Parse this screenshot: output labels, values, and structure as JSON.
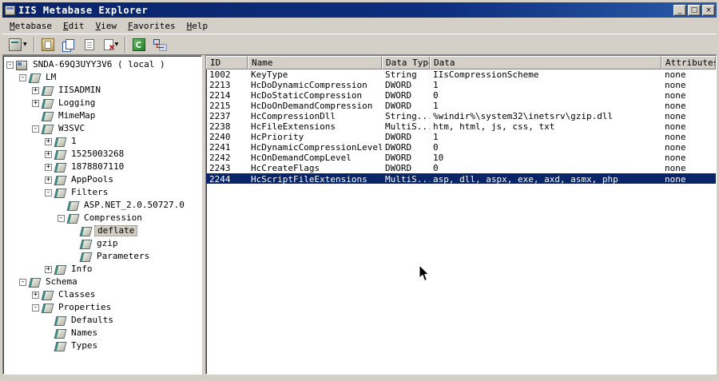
{
  "window": {
    "title": "IIS Metabase Explorer",
    "controls": {
      "minimize": "_",
      "maximize": "□",
      "close": "×"
    }
  },
  "menu": {
    "items": [
      {
        "label": "Metabase"
      },
      {
        "label": "Edit"
      },
      {
        "label": "View"
      },
      {
        "label": "Favorites"
      },
      {
        "label": "Help"
      }
    ]
  },
  "toolbar": {
    "buttons": [
      {
        "name": "new-key-button",
        "icon": "new-key-icon",
        "dropdown": true
      },
      {
        "sep": true
      },
      {
        "name": "paste-button",
        "icon": "clipboard-icon"
      },
      {
        "name": "copy-button",
        "icon": "copy-icon"
      },
      {
        "name": "export-button",
        "icon": "page-icon"
      },
      {
        "name": "delete-button",
        "icon": "delete-icon",
        "dropdown": true
      },
      {
        "sep": true
      },
      {
        "name": "refresh-button",
        "icon": "refresh-icon"
      },
      {
        "name": "connect-button",
        "icon": "network-icon"
      }
    ]
  },
  "tree": {
    "items": [
      {
        "label": "SNDA-69Q3UYY3V6 ( local )",
        "level": 0,
        "expand": "minus",
        "icon": "computer"
      },
      {
        "label": "LM",
        "level": 1,
        "expand": "minus",
        "icon": "key"
      },
      {
        "label": "IISADMIN",
        "level": 2,
        "expand": "plus",
        "icon": "key"
      },
      {
        "label": "Logging",
        "level": 2,
        "expand": "plus",
        "icon": "key"
      },
      {
        "label": "MimeMap",
        "level": 2,
        "expand": "none",
        "icon": "key"
      },
      {
        "label": "W3SVC",
        "level": 2,
        "expand": "minus",
        "icon": "key"
      },
      {
        "label": "1",
        "level": 3,
        "expand": "plus",
        "icon": "key"
      },
      {
        "label": "1525003268",
        "level": 3,
        "expand": "plus",
        "icon": "key"
      },
      {
        "label": "1878807110",
        "level": 3,
        "expand": "plus",
        "icon": "key"
      },
      {
        "label": "AppPools",
        "level": 3,
        "expand": "plus",
        "icon": "key"
      },
      {
        "label": "Filters",
        "level": 3,
        "expand": "minus",
        "icon": "key"
      },
      {
        "label": "ASP.NET_2.0.50727.0",
        "level": 4,
        "expand": "none",
        "icon": "key"
      },
      {
        "label": "Compression",
        "level": 4,
        "expand": "minus",
        "icon": "key"
      },
      {
        "label": "deflate",
        "level": 5,
        "expand": "none",
        "icon": "key",
        "selected": true
      },
      {
        "label": "gzip",
        "level": 5,
        "expand": "none",
        "icon": "key"
      },
      {
        "label": "Parameters",
        "level": 5,
        "expand": "none",
        "icon": "key"
      },
      {
        "label": "Info",
        "level": 3,
        "expand": "plus",
        "icon": "key"
      },
      {
        "label": "Schema",
        "level": 1,
        "expand": "minus",
        "icon": "key"
      },
      {
        "label": "Classes",
        "level": 2,
        "expand": "plus",
        "icon": "key"
      },
      {
        "label": "Properties",
        "level": 2,
        "expand": "minus",
        "icon": "key"
      },
      {
        "label": "Defaults",
        "level": 3,
        "expand": "none",
        "icon": "key"
      },
      {
        "label": "Names",
        "level": 3,
        "expand": "none",
        "icon": "key"
      },
      {
        "label": "Types",
        "level": 3,
        "expand": "none",
        "icon": "key"
      }
    ]
  },
  "table": {
    "columns": [
      "ID",
      "Name",
      "Data Type",
      "Data",
      "Attributes"
    ],
    "rows": [
      [
        "1002",
        "KeyType",
        "String",
        "IIsCompressionScheme",
        "none"
      ],
      [
        "2213",
        "HcDoDynamicCompression",
        "DWORD",
        "1",
        "none"
      ],
      [
        "2214",
        "HcDoStaticCompression",
        "DWORD",
        "0",
        "none"
      ],
      [
        "2215",
        "HcDoOnDemandCompression",
        "DWORD",
        "1",
        "none"
      ],
      [
        "2237",
        "HcCompressionDll",
        "String...",
        "%windir%\\system32\\inetsrv\\gzip.dll",
        "none"
      ],
      [
        "2238",
        "HcFileExtensions",
        "MultiS...",
        "htm, html, js, css, txt",
        "none"
      ],
      [
        "2240",
        "HcPriority",
        "DWORD",
        "1",
        "none"
      ],
      [
        "2241",
        "HcDynamicCompressionLevel",
        "DWORD",
        "0",
        "none"
      ],
      [
        "2242",
        "HcOnDemandCompLevel",
        "DWORD",
        "10",
        "none"
      ],
      [
        "2243",
        "HcCreateFlags",
        "DWORD",
        "0",
        "none"
      ],
      [
        "2244",
        "HcScriptFileExtensions",
        "MultiS...",
        "asp, dll, aspx, exe, axd, asmx, php",
        "none"
      ]
    ],
    "selected_row": "2244"
  }
}
